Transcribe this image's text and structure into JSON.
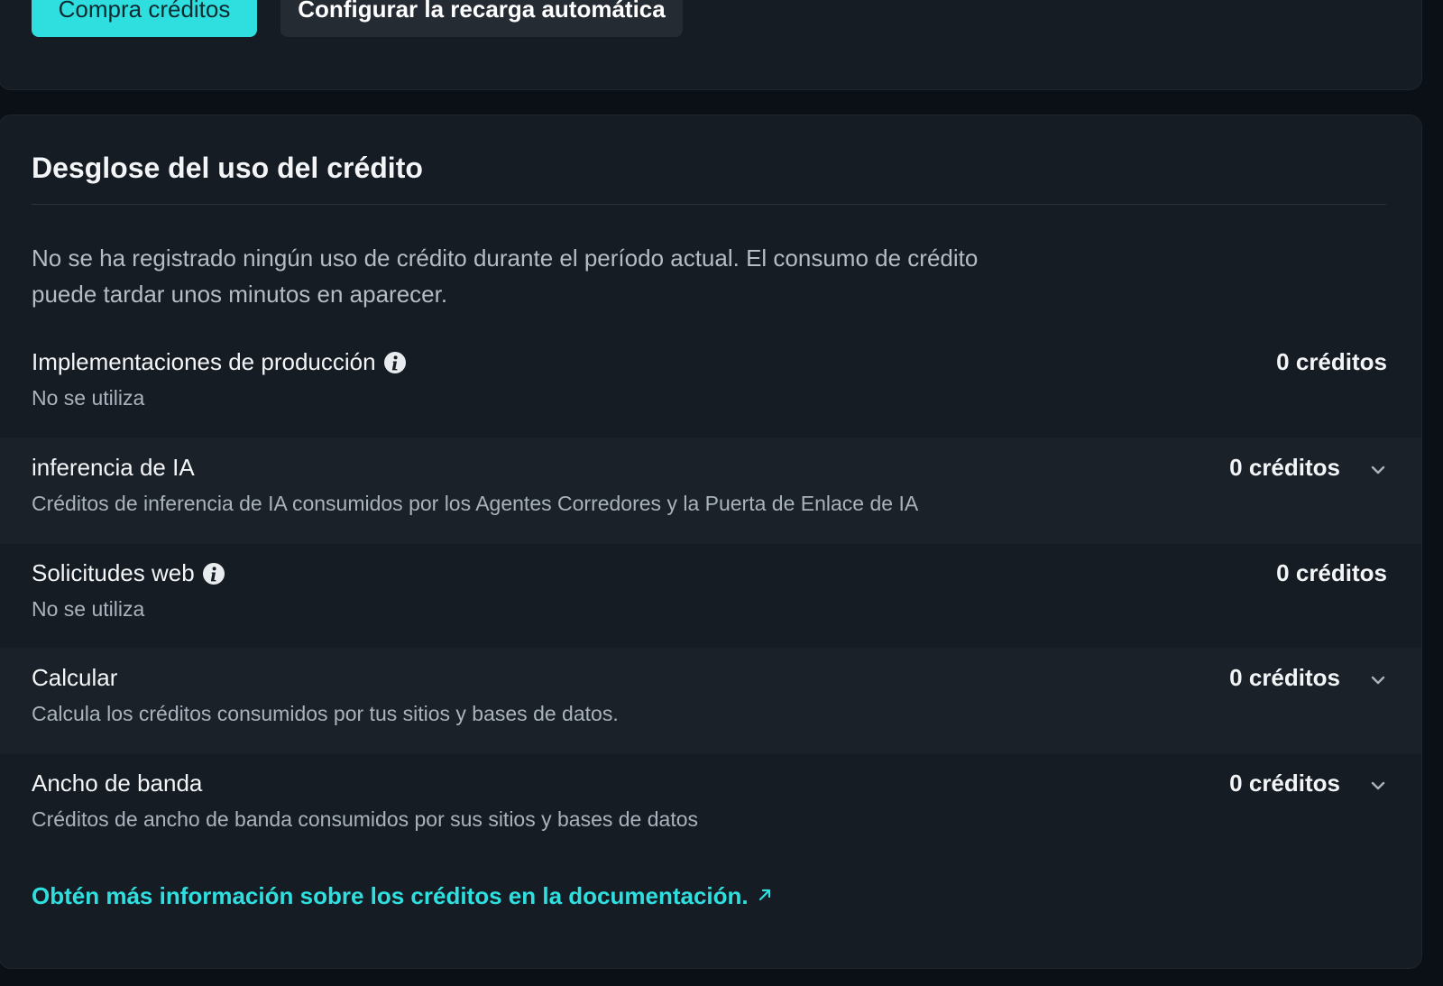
{
  "top_actions": {
    "buy_label": "Compra créditos",
    "auto_recharge_label": "Configurar la recarga automática"
  },
  "breakdown": {
    "title": "Desglose del uso del crédito",
    "notice": "No se ha registrado ningún uso de crédito durante el período actual. El consumo de crédito puede tardar unos minutos en aparecer.",
    "items": [
      {
        "title": "Implementaciones de producción",
        "subtitle": "No se utiliza",
        "value": "0 créditos"
      },
      {
        "title": "inferencia de IA",
        "subtitle": "Créditos de inferencia de IA consumidos por los Agentes Corredores y la Puerta de Enlace de IA",
        "value": "0 créditos"
      },
      {
        "title": "Solicitudes web",
        "subtitle": "No se utiliza",
        "value": "0 créditos"
      },
      {
        "title": "Calcular",
        "subtitle": "Calcula los créditos consumidos por tus sitios y bases de datos.",
        "value": "0 créditos"
      },
      {
        "title": "Ancho de banda",
        "subtitle": "Créditos de ancho de banda consumidos por sus sitios y bases de datos",
        "value": "0 créditos"
      }
    ],
    "docs_link": "Obtén más información sobre los créditos en la documentación.",
    "docs_link_icon": "external-arrow-icon"
  },
  "colors": {
    "accent": "#2fdfe0",
    "background": "#0a1016",
    "card": "#161c24",
    "row_alt": "#1a2129"
  }
}
